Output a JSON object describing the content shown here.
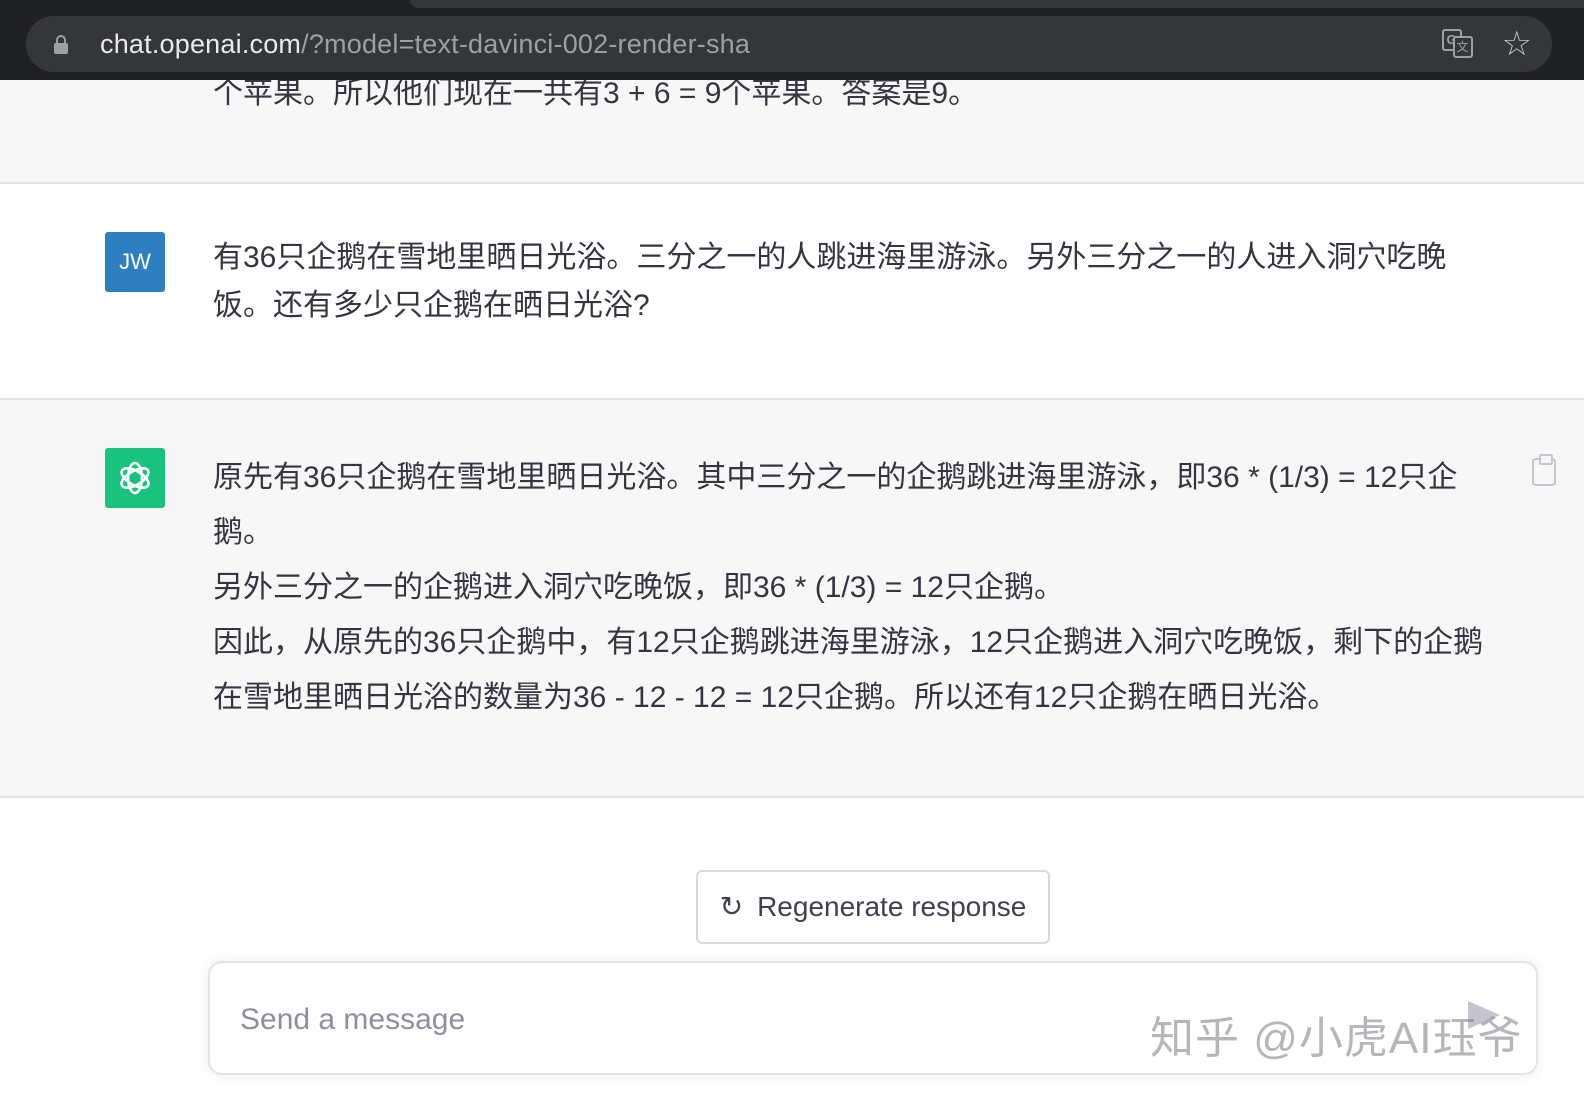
{
  "browser": {
    "url_host": "chat.openai.com",
    "url_path": "/?model=text-davinci-002-render-sha"
  },
  "conversation": {
    "previous_tail": "个苹果。所以他们现在一共有3 + 6 = 9个苹果。答案是9。",
    "user": {
      "avatar_initials": "JW",
      "text": "有36只企鹅在雪地里晒日光浴。三分之一的人跳进海里游泳。另外三分之一的人进入洞穴吃晚饭。还有多少只企鹅在晒日光浴?"
    },
    "assistant": {
      "paragraphs": [
        "原先有36只企鹅在雪地里晒日光浴。其中三分之一的企鹅跳进海里游泳，即36 * (1/3) = 12只企鹅。",
        "另外三分之一的企鹅进入洞穴吃晚饭，即36 * (1/3) = 12只企鹅。",
        "因此，从原先的36只企鹅中，有12只企鹅跳进海里游泳，12只企鹅进入洞穴吃晚饭，剩下的企鹅在雪地里晒日光浴的数量为36 - 12 - 12 = 12只企鹅。所以还有12只企鹅在晒日光浴。"
      ]
    }
  },
  "regenerate_label": "Regenerate response",
  "composer": {
    "placeholder": "Send a message",
    "value": ""
  },
  "watermark": "知乎 @小虎AI珏爷",
  "colors": {
    "user_avatar": "#2e7fc0",
    "assistant_avatar": "#19c37d",
    "assistant_bg": "#f7f7f8"
  },
  "icons": [
    "lock-icon",
    "translate-icon",
    "star-icon",
    "openai-logo-icon",
    "clipboard-icon",
    "refresh-icon",
    "send-icon"
  ]
}
